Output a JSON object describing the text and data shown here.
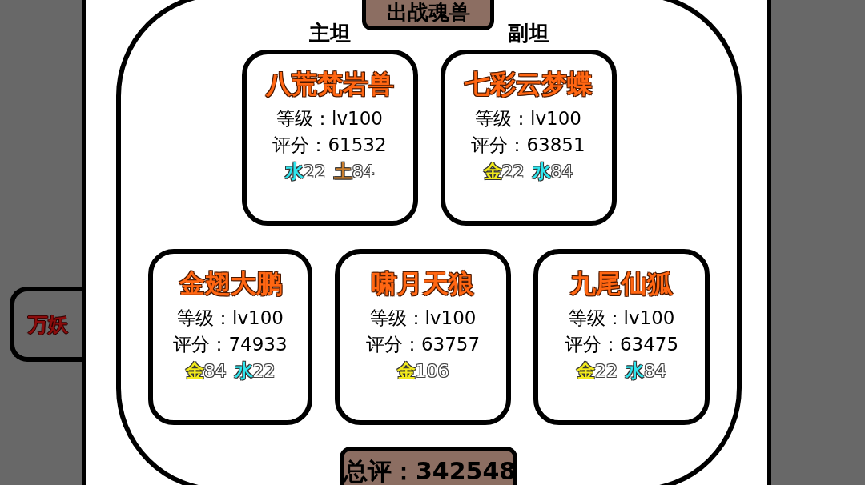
{
  "side_card": {
    "label": "万妖"
  },
  "team": {
    "title": "出战魂兽",
    "rows": [
      {
        "beasts": [
          {
            "role": "主坦",
            "name": "八荒梵岩兽",
            "level_text": "等级：lv100",
            "score_text": "评分：61532",
            "elements": [
              {
                "element": "水",
                "value": "22",
                "color": "#2ee6ee"
              },
              {
                "element": "土",
                "value": "84",
                "color": "#c97d2c"
              }
            ]
          },
          {
            "role": "副坦",
            "name": "七彩云梦蝶",
            "level_text": "等级：lv100",
            "score_text": "评分：63851",
            "elements": [
              {
                "element": "金",
                "value": "22",
                "color": "#f2ea1c"
              },
              {
                "element": "水",
                "value": "84",
                "color": "#2ee6ee"
              }
            ]
          }
        ]
      },
      {
        "beasts": [
          {
            "name": "金翅大鹏",
            "level_text": "等级：lv100",
            "score_text": "评分：74933",
            "elements": [
              {
                "element": "金",
                "value": "84",
                "color": "#f2ea1c"
              },
              {
                "element": "水",
                "value": "22",
                "color": "#2ee6ee"
              }
            ]
          },
          {
            "name": "啸月天狼",
            "level_text": "等级：lv100",
            "score_text": "评分：63757",
            "elements": [
              {
                "element": "金",
                "value": "106",
                "color": "#f2ea1c"
              }
            ]
          },
          {
            "name": "九尾仙狐",
            "level_text": "等级：lv100",
            "score_text": "评分：63475",
            "elements": [
              {
                "element": "金",
                "value": "22",
                "color": "#f2ea1c"
              },
              {
                "element": "水",
                "value": "84",
                "color": "#2ee6ee"
              }
            ]
          }
        ]
      }
    ],
    "total": "总评：342548"
  }
}
